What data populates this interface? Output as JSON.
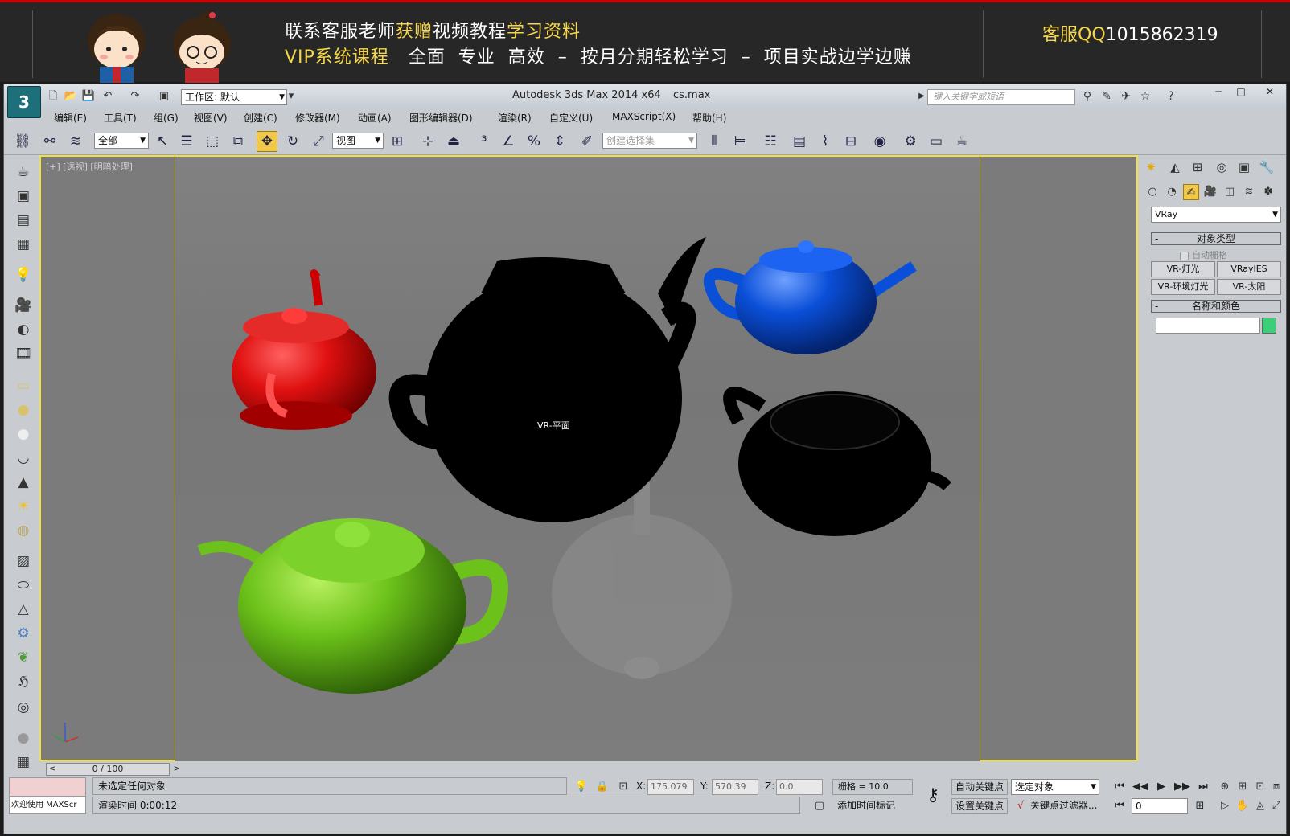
{
  "banner": {
    "line1_a": "联系客服老师",
    "line1_b": "获赠",
    "line1_c": "视频教程",
    "line1_d": "学习资料",
    "line2_a": "VIP系统课程",
    "line2_b": "全面  专业  高效  –  按月分期轻松学习  –  项目实战边学边赚",
    "qq_label": "客服QQ",
    "qq_number": "1015862319"
  },
  "window": {
    "workspace": "工作区: 默认",
    "title": "Autodesk 3ds Max  2014 x64",
    "file": "cs.max",
    "search_placeholder": "键入关键字或短语",
    "min": "─",
    "max": "□",
    "close": "✕"
  },
  "menu": [
    "编辑(E)",
    "工具(T)",
    "组(G)",
    "视图(V)",
    "创建(C)",
    "修改器(M)",
    "动画(A)",
    "图形编辑器(D)",
    "渲染(R)",
    "自定义(U)",
    "MAXScript(X)",
    "帮助(H)"
  ],
  "toolbar": {
    "filter": "全部",
    "ref_coord": "视图",
    "selection_set": "创建选择集"
  },
  "viewport": {
    "label": "[+] [透视] [明暗处理]",
    "plane_label": "VR-平面"
  },
  "teapots": {
    "red": "#e01010",
    "black": "#000000",
    "blue": "#0a4fd8",
    "green": "#6cc21a",
    "plane": "#3de08a"
  },
  "panel": {
    "renderer": "VRay",
    "object_type": "对象类型",
    "auto_grid": "自动栅格",
    "buttons": [
      "VR-灯光",
      "VRayIES",
      "VR-环境灯光",
      "VR-太阳"
    ],
    "name_color": "名称和颜色",
    "swatch": "#3dcf78"
  },
  "timeline": {
    "frame": "0 / 100"
  },
  "status": {
    "welcome": "欢迎使用 MAXScr",
    "selection": "未选定任何对象",
    "render_time": "渲染时间  0:00:12",
    "x_label": "X:",
    "x_value": "175.079",
    "y_label": "Y:",
    "y_value": "570.39",
    "z_label": "Z:",
    "z_value": "0.0",
    "grid": "栅格 = 10.0",
    "add_time_tag": "添加时间标记",
    "auto_key": "自动关键点",
    "set_key": "设置关键点",
    "selected_object": "选定对象",
    "key_filters": "关键点过滤器...",
    "current_frame": "0"
  }
}
